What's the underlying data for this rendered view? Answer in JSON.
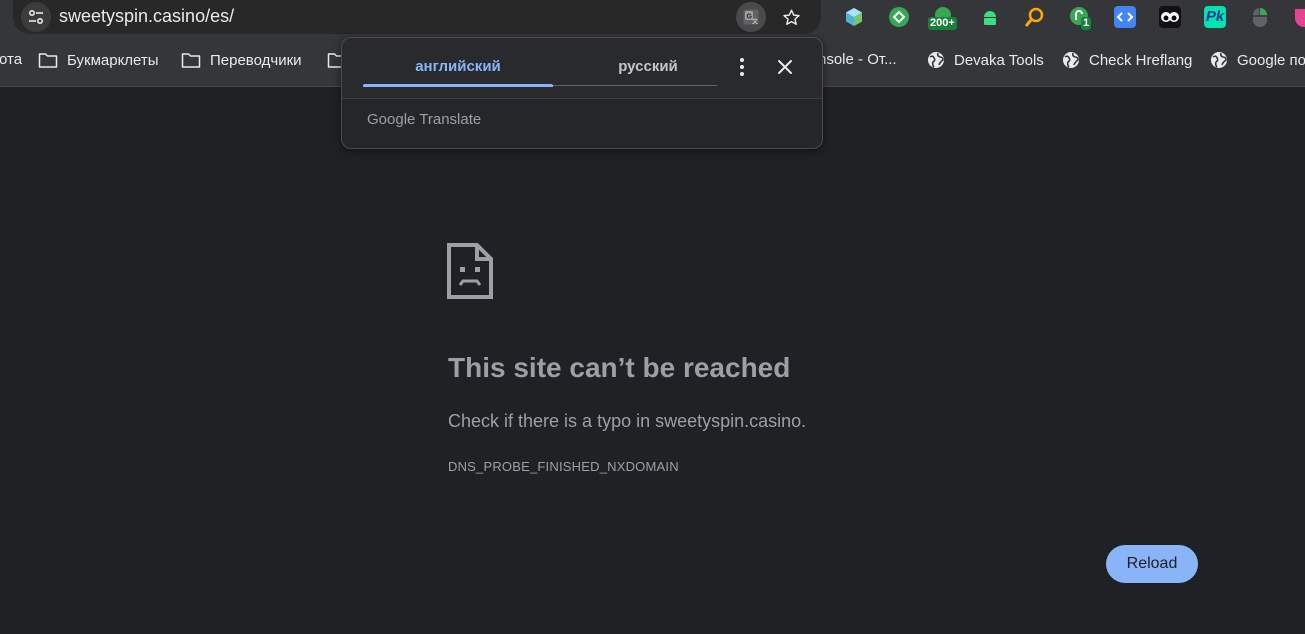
{
  "omnibox": {
    "url": "sweetyspin.casino/es/"
  },
  "extensions": [
    {
      "name": "hexagon-extension-icon",
      "color": "#4fb3d9"
    },
    {
      "name": "green-clover-extension-icon",
      "color": "#34a853"
    },
    {
      "name": "green-counter-extension-icon",
      "color": "#34a853",
      "badge": "200+"
    },
    {
      "name": "android-extension-icon",
      "color": "#3ddc84"
    },
    {
      "name": "magnifier-extension-icon",
      "color": "#f9ab00"
    },
    {
      "name": "green-link-extension-icon",
      "color": "#34a853",
      "badge": "1"
    },
    {
      "name": "code-extension-icon",
      "color": "#4285f4"
    },
    {
      "name": "eyes-extension-icon",
      "color": "#ffffff"
    },
    {
      "name": "pk-extension-icon",
      "color": "#00e5b0",
      "label": "Pk"
    },
    {
      "name": "mouse-extension-icon",
      "color": "#5f6368"
    },
    {
      "name": "shield-extension-icon",
      "color": "#e84393"
    }
  ],
  "bookmarks": [
    {
      "label": "ота",
      "icon": "none"
    },
    {
      "label": "Букмарклеты",
      "icon": "folder-icon"
    },
    {
      "label": "Переводчики",
      "icon": "folder-icon"
    },
    {
      "label": "nsole - От...",
      "icon": "none"
    },
    {
      "label": "Devaka Tools",
      "icon": "globe-icon"
    },
    {
      "label": "Check Hreflang",
      "icon": "globe-icon"
    },
    {
      "label": "Google по",
      "icon": "globe-icon"
    }
  ],
  "translate_popup": {
    "tabs": [
      {
        "label": "английский",
        "active": true
      },
      {
        "label": "русский",
        "active": false
      }
    ],
    "brand": "Google Translate",
    "accent": "#8ab4f8"
  },
  "error": {
    "title": "This site can’t be reached",
    "description": "Check if there is a typo in sweetyspin.casino.",
    "code": "DNS_PROBE_FINISHED_NXDOMAIN",
    "reload_label": "Reload"
  }
}
